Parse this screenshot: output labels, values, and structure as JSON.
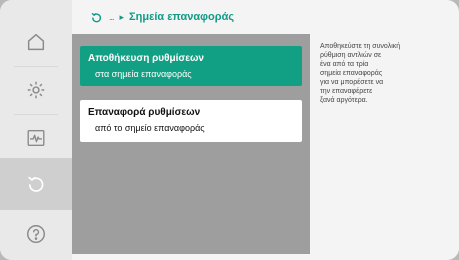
{
  "header": {
    "back_icon": "back-icon",
    "breadcrumb_dots": "...",
    "breadcrumb_arrow": "▸",
    "title": "Σημεία επαναφοράς"
  },
  "sidebar": {
    "items": [
      {
        "name": "home",
        "icon": "home-icon"
      },
      {
        "name": "settings",
        "icon": "gear-icon"
      },
      {
        "name": "diagnostics",
        "icon": "pulse-icon"
      },
      {
        "name": "restore",
        "icon": "restore-icon",
        "active": true
      },
      {
        "name": "help",
        "icon": "help-icon"
      }
    ]
  },
  "menu": {
    "items": [
      {
        "label": "Αποθήκευση ρυθμίσεων",
        "sub": "στα σημεία επαναφοράς",
        "selected": true
      },
      {
        "label": "Επαναφορά ρυθμίσεων",
        "sub": "από το σημείο επαναφοράς",
        "selected": false
      }
    ]
  },
  "help": {
    "text_lines": [
      "Αποθηκεύστε τη συνολική",
      "ρύθμιση αντλιών σε",
      "ένα από τα τρία",
      "σημεία επαναφοράς",
      "για να μπορέσετε να",
      "την επαναφέρετε",
      "ξανά αργότερα."
    ]
  },
  "colors": {
    "accent": "#12a085",
    "menu_bg": "#9e9e9e",
    "sidebar_bg": "#e9e9e9",
    "active_bg": "#cfcfcf"
  }
}
